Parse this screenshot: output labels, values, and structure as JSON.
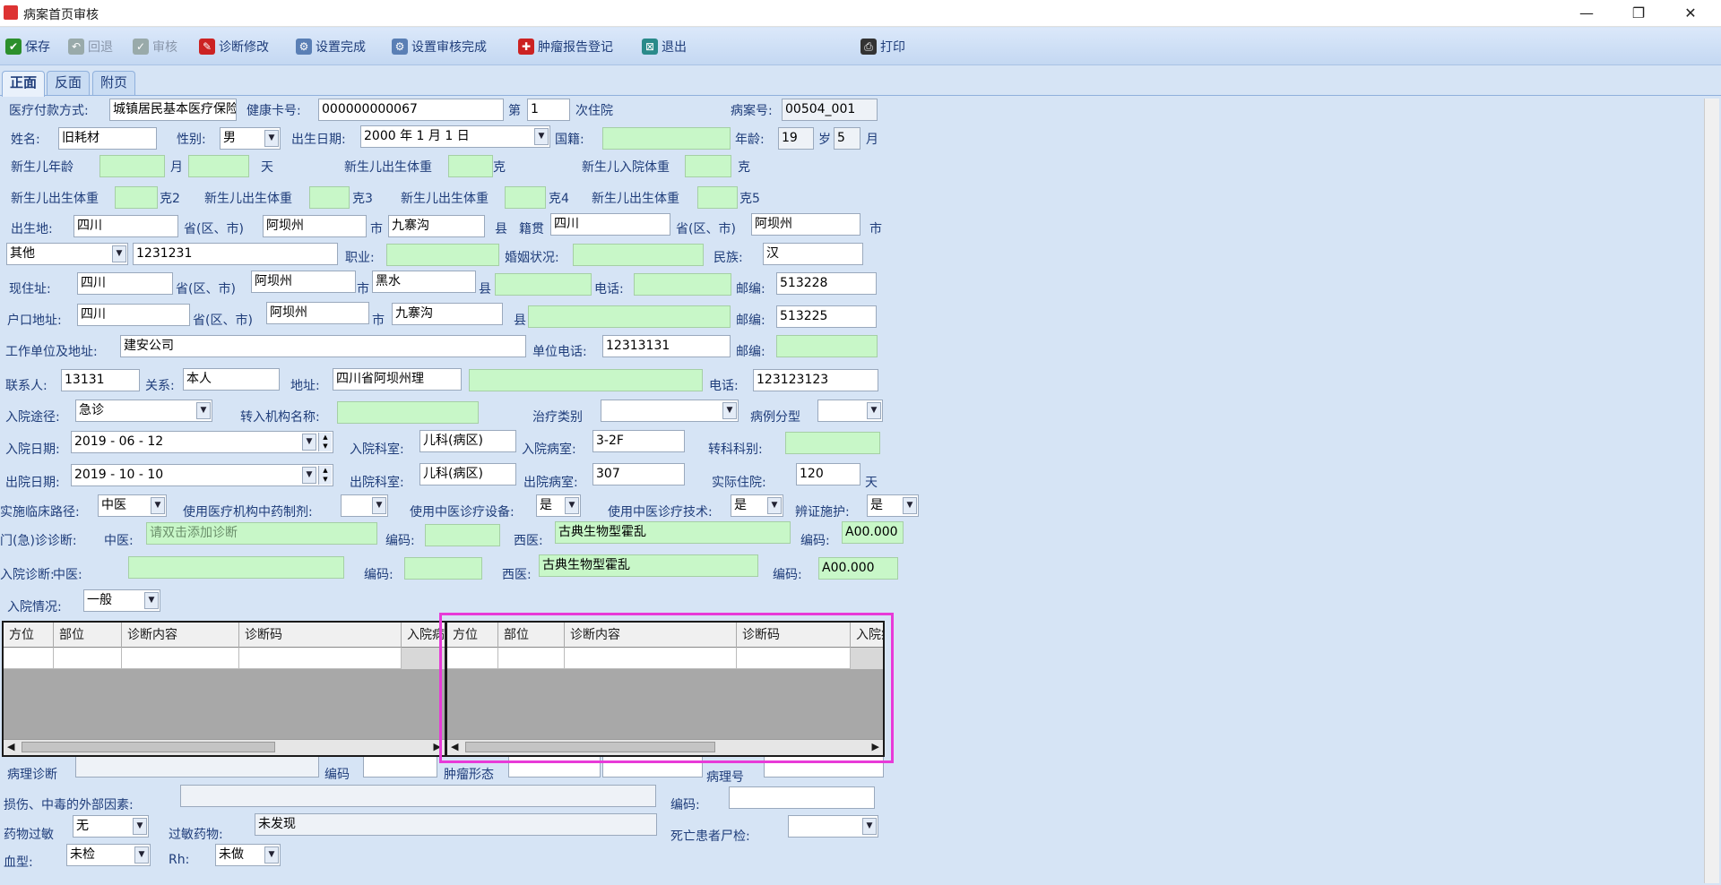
{
  "window": {
    "title": "病案首页审核",
    "min": "—",
    "max": "❐",
    "close": "✕"
  },
  "toolbar": [
    {
      "label": "保存",
      "icon": "save-icon",
      "enabled": true,
      "color": "#2c8f2c"
    },
    {
      "label": "回退",
      "icon": "undo-icon",
      "enabled": false,
      "color": "#9aa"
    },
    {
      "label": "审核",
      "icon": "check-icon",
      "enabled": false,
      "color": "#9aa"
    },
    {
      "label": "诊断修改",
      "icon": "edit-icon",
      "enabled": true,
      "color": "#c22"
    },
    {
      "label": "设置完成",
      "icon": "settings-icon",
      "enabled": true,
      "color": "#5a7fb5"
    },
    {
      "label": "设置审核完成",
      "icon": "settings-check-icon",
      "enabled": true,
      "color": "#5a7fb5"
    },
    {
      "label": "肿瘤报告登记",
      "icon": "report-icon",
      "enabled": true,
      "color": "#c22"
    },
    {
      "label": "退出",
      "icon": "exit-icon",
      "enabled": true,
      "color": "#2a8a8a"
    },
    {
      "label": "打印",
      "icon": "print-icon",
      "enabled": true,
      "color": "#333"
    }
  ],
  "tabs": [
    "正面",
    "反面",
    "附页"
  ],
  "form": {
    "payment_label": "医疗付款方式:",
    "payment": "城镇居民基本医疗保险",
    "health_card_label": "健康卡号:",
    "health_card": "000000000067",
    "nth_label": "第",
    "nth": "1",
    "nth_suffix": "次住院",
    "case_no_label": "病案号:",
    "case_no": "00504_001",
    "name_label": "姓名:",
    "name": "旧耗材",
    "sex_label": "性别:",
    "sex": "男",
    "dob_label": "出生日期:",
    "dob": "2000 年 1 月 1 日",
    "nationality_label": "国籍:",
    "nationality": "",
    "age_label": "年龄:",
    "age": "19",
    "age_unit": "岁",
    "age_month": "5",
    "month_unit": "月",
    "newborn_age_label": "新生儿年龄",
    "nb_month_unit": "月",
    "nb_day_unit": "天",
    "nb_birth_weight_label": "新生儿出生体重",
    "gram": "克",
    "nb_admit_weight_label": "新生儿入院体重",
    "gram2": "克2",
    "gram3": "克3",
    "gram4": "克4",
    "gram5": "克5",
    "birthplace_label": "出生地:",
    "birth_province": "四川",
    "prov_label": "省(区、市)",
    "birth_city": "阿坝州",
    "city_label": "市",
    "birth_county": "九寨沟",
    "county_label": "县",
    "native_label": "籍贯",
    "native_province": "四川",
    "native_city": "阿坝州",
    "id_type": "其他",
    "id_no": "1231231",
    "job_label": "职业:",
    "job": "",
    "marital_label": "婚姻状况:",
    "marital": "",
    "ethnic_label": "民族:",
    "ethnic": "汉",
    "cur_addr_label": "现住址:",
    "cur_province": "四川",
    "cur_city": "阿坝州",
    "cur_county": "黑水",
    "phone_label": "电话:",
    "zip_label": "邮编:",
    "cur_zip": "513228",
    "reg_addr_label": "户口地址:",
    "reg_province": "四川",
    "reg_city": "阿坝州",
    "reg_county": "九寨沟",
    "reg_zip": "513225",
    "work_label": "工作单位及地址:",
    "work": "建安公司",
    "work_phone_label": "单位电话:",
    "work_phone": "12313131",
    "contact_label": "联系人:",
    "contact": "13131",
    "relation_label": "关系:",
    "relation": "本人",
    "contact_addr_label": "地址:",
    "contact_addr": "四川省阿坝州理",
    "contact_phone": "123123123",
    "admit_route_label": "入院途径:",
    "admit_route": "急诊",
    "transfer_in_label": "转入机构名称:",
    "treat_type_label": "治疗类别",
    "case_type_label": "病例分型",
    "admit_date_label": "入院日期:",
    "admit_date": "2019 - 06 - 12",
    "admit_dept_label": "入院科室:",
    "admit_dept": "儿科(病区)",
    "admit_ward_label": "入院病室:",
    "admit_ward": "3-2F",
    "transfer_dept_label": "转科科别:",
    "disc_date_label": "出院日期:",
    "disc_date": "2019 - 10 - 10",
    "disc_dept_label": "出院科室:",
    "disc_dept": "儿科(病区)",
    "disc_ward_label": "出院病室:",
    "disc_ward": "307",
    "los_label": "实际住院:",
    "los": "120",
    "los_unit": "天",
    "clin_path_label": "实施临床路径:",
    "clin_path": "中医",
    "tcm_prep_label": "使用医疗机构中药制剂:",
    "tcm_equip_label": "使用中医诊疗设备:",
    "tcm_equip": "是",
    "tcm_tech_label": "使用中医诊疗技术:",
    "tcm_tech": "是",
    "syndrome_label": "辨证施护:",
    "syndrome": "是",
    "op_diag_label": "门(急)诊诊断:",
    "tcm_label": "中医:",
    "op_tcm_placeholder": "请双击添加诊断",
    "code_label": "编码:",
    "wm_label": "西医:",
    "op_wm": "古典生物型霍乱",
    "op_code": "A00.000",
    "admit_diag_label": "入院诊断:",
    "admit_tcm_label": "中医:",
    "admit_wm": "古典生物型霍乱",
    "admit_code": "A00.000",
    "admit_cond_label": "入院情况:",
    "admit_cond": "一般",
    "grid_cols": [
      "方位",
      "部位",
      "诊断内容",
      "诊断码",
      "入院病"
    ],
    "path_diag_label": "病理诊断",
    "code_label2": "编码",
    "tumor_label": "肿瘤形态",
    "path_no_label": "病理号",
    "injury_label": "损伤、中毒的外部因素:",
    "code_label3": "编码:",
    "allergy_label": "药物过敏",
    "allergy": "无",
    "allergy_drug_label": "过敏药物:",
    "allergy_drug": "未发现",
    "autopsy_label": "死亡患者尸检:",
    "blood_label": "血型:",
    "blood": "未检",
    "rh_label": "Rh:",
    "rh": "未做"
  },
  "highlight_color": "#e83ad8"
}
